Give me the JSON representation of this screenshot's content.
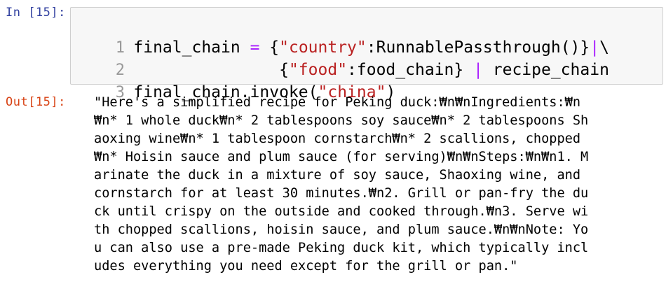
{
  "cell": {
    "in_prompt": "In [15]:",
    "out_prompt": "Out[15]:"
  },
  "code": {
    "line_numbers": [
      "1",
      "2",
      "3"
    ],
    "line1": {
      "a": "final_chain ",
      "eq": "=",
      "b": " {",
      "str1": "\"country\"",
      "c": ":RunnablePassthrough()}",
      "pipe": "|",
      "d": "\\"
    },
    "line2": {
      "indent": "               {",
      "str1": "\"food\"",
      "c": ":food_chain} ",
      "pipe": "|",
      "d": " recipe_chain"
    },
    "line3": {
      "a": "final_chain.invoke(",
      "str1": "\"china\"",
      "b": ")"
    }
  },
  "output": {
    "lines": [
      "\"Here's a simplified recipe for Peking duck:₩n₩nIngredients:₩n",
      "₩n* 1 whole duck₩n* 2 tablespoons soy sauce₩n* 2 tablespoons Sh",
      "aoxing wine₩n* 1 tablespoon cornstarch₩n* 2 scallions, chopped",
      "₩n* Hoisin sauce and plum sauce (for serving)₩n₩nSteps:₩n₩n1. M",
      "arinate the duck in a mixture of soy sauce, Shaoxing wine, and",
      "cornstarch for at least 30 minutes.₩n2. Grill or pan-fry the du",
      "ck until crispy on the outside and cooked through.₩n3. Serve wi",
      "th chopped scallions, hoisin sauce, and plum sauce.₩n₩nNote: Yo",
      "u can also use a pre-made Peking duck kit, which typically incl",
      "udes everything you need except for the grill or pan.\""
    ]
  }
}
